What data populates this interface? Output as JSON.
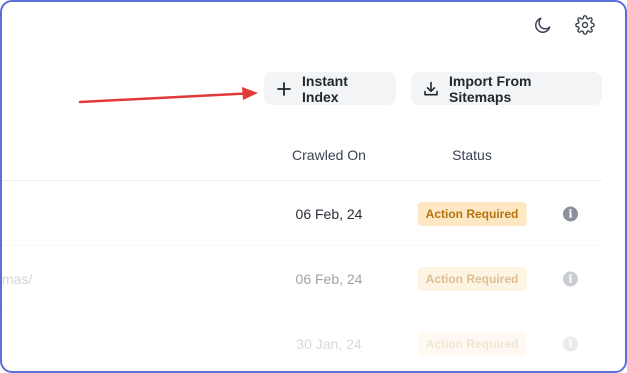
{
  "header": {
    "icons": [
      "moon-icon",
      "gear-icon"
    ]
  },
  "toolbar": {
    "instant_index_label": "Instant Index",
    "import_sitemaps_label": "Import From Sitemaps"
  },
  "annotation": {
    "arrow_color": "#e03a3a"
  },
  "table": {
    "columns": [
      "Crawled On",
      "Status"
    ],
    "rows": [
      {
        "path": "",
        "crawled_on": "06 Feb, 24",
        "status": "Action Required"
      },
      {
        "path": "tmas/",
        "crawled_on": "06 Feb, 24",
        "status": "Action Required"
      },
      {
        "path": "",
        "crawled_on": "30 Jan, 24",
        "status": "Action Required"
      }
    ]
  },
  "colors": {
    "accent_border": "#5a6fd8",
    "badge_bg": "#fde8c3",
    "badge_text": "#b7730f",
    "button_bg": "#f3f4f6"
  }
}
